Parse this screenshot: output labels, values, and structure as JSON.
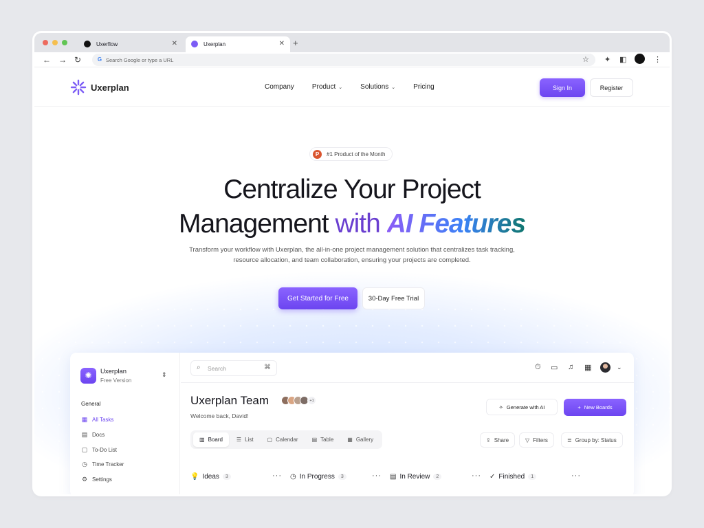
{
  "browser": {
    "tabs": [
      {
        "title": "Uxerflow"
      },
      {
        "title": "Uxerplan"
      }
    ],
    "new_tab": "+",
    "address_placeholder": "Search Google or type a URL"
  },
  "site": {
    "brand": "Uxerplan",
    "nav": {
      "company": "Company",
      "product": "Product",
      "solutions": "Solutions",
      "pricing": "Pricing"
    },
    "signin": "Sign In",
    "register": "Register"
  },
  "hero": {
    "badge": "#1 Product of the Month",
    "title_line1": "Centralize Your Project",
    "title_line2_a": "Management",
    "title_line2_b": "with",
    "title_line2_c": "AI Features",
    "subtitle": "Transform your workflow with Uxerplan, the all-in-one project management solution that centralizes task tracking, resource allocation, and team collaboration, ensuring your projects are completed.",
    "cta_primary": "Get Started for Free",
    "cta_secondary": "30-Day Free Trial"
  },
  "app": {
    "workspace": {
      "name": "Uxerplan",
      "plan": "Free Version"
    },
    "section_general": "General",
    "sidebar": [
      {
        "label": "All Tasks",
        "icon": "grid-icon"
      },
      {
        "label": "Docs",
        "icon": "docs-icon"
      },
      {
        "label": "To-Do List",
        "icon": "calendar-icon"
      },
      {
        "label": "Time Tracker",
        "icon": "clock-icon"
      },
      {
        "label": "Settings",
        "icon": "settings-icon"
      }
    ],
    "search_placeholder": "Search",
    "search_shortcut": "⌘",
    "team_title": "Uxerplan Team",
    "team_extra": "+1",
    "welcome": "Welcome back, David!",
    "generate_ai": "Generate with AI",
    "new_boards": "New Boards",
    "views": [
      "Board",
      "List",
      "Calendar",
      "Table",
      "Gallery"
    ],
    "tools": {
      "share": "Share",
      "filters": "Filters",
      "group": "Group by: Status"
    },
    "columns": [
      {
        "title": "Ideas",
        "count": "3"
      },
      {
        "title": "In Progress",
        "count": "3"
      },
      {
        "title": "In Review",
        "count": "2"
      },
      {
        "title": "Finished",
        "count": "1"
      }
    ]
  },
  "colors": {
    "accent": "#6c45f0",
    "accent_light": "#8a63ff",
    "gradient_blue": "#3b82f6",
    "gradient_teal": "#0f766e"
  }
}
